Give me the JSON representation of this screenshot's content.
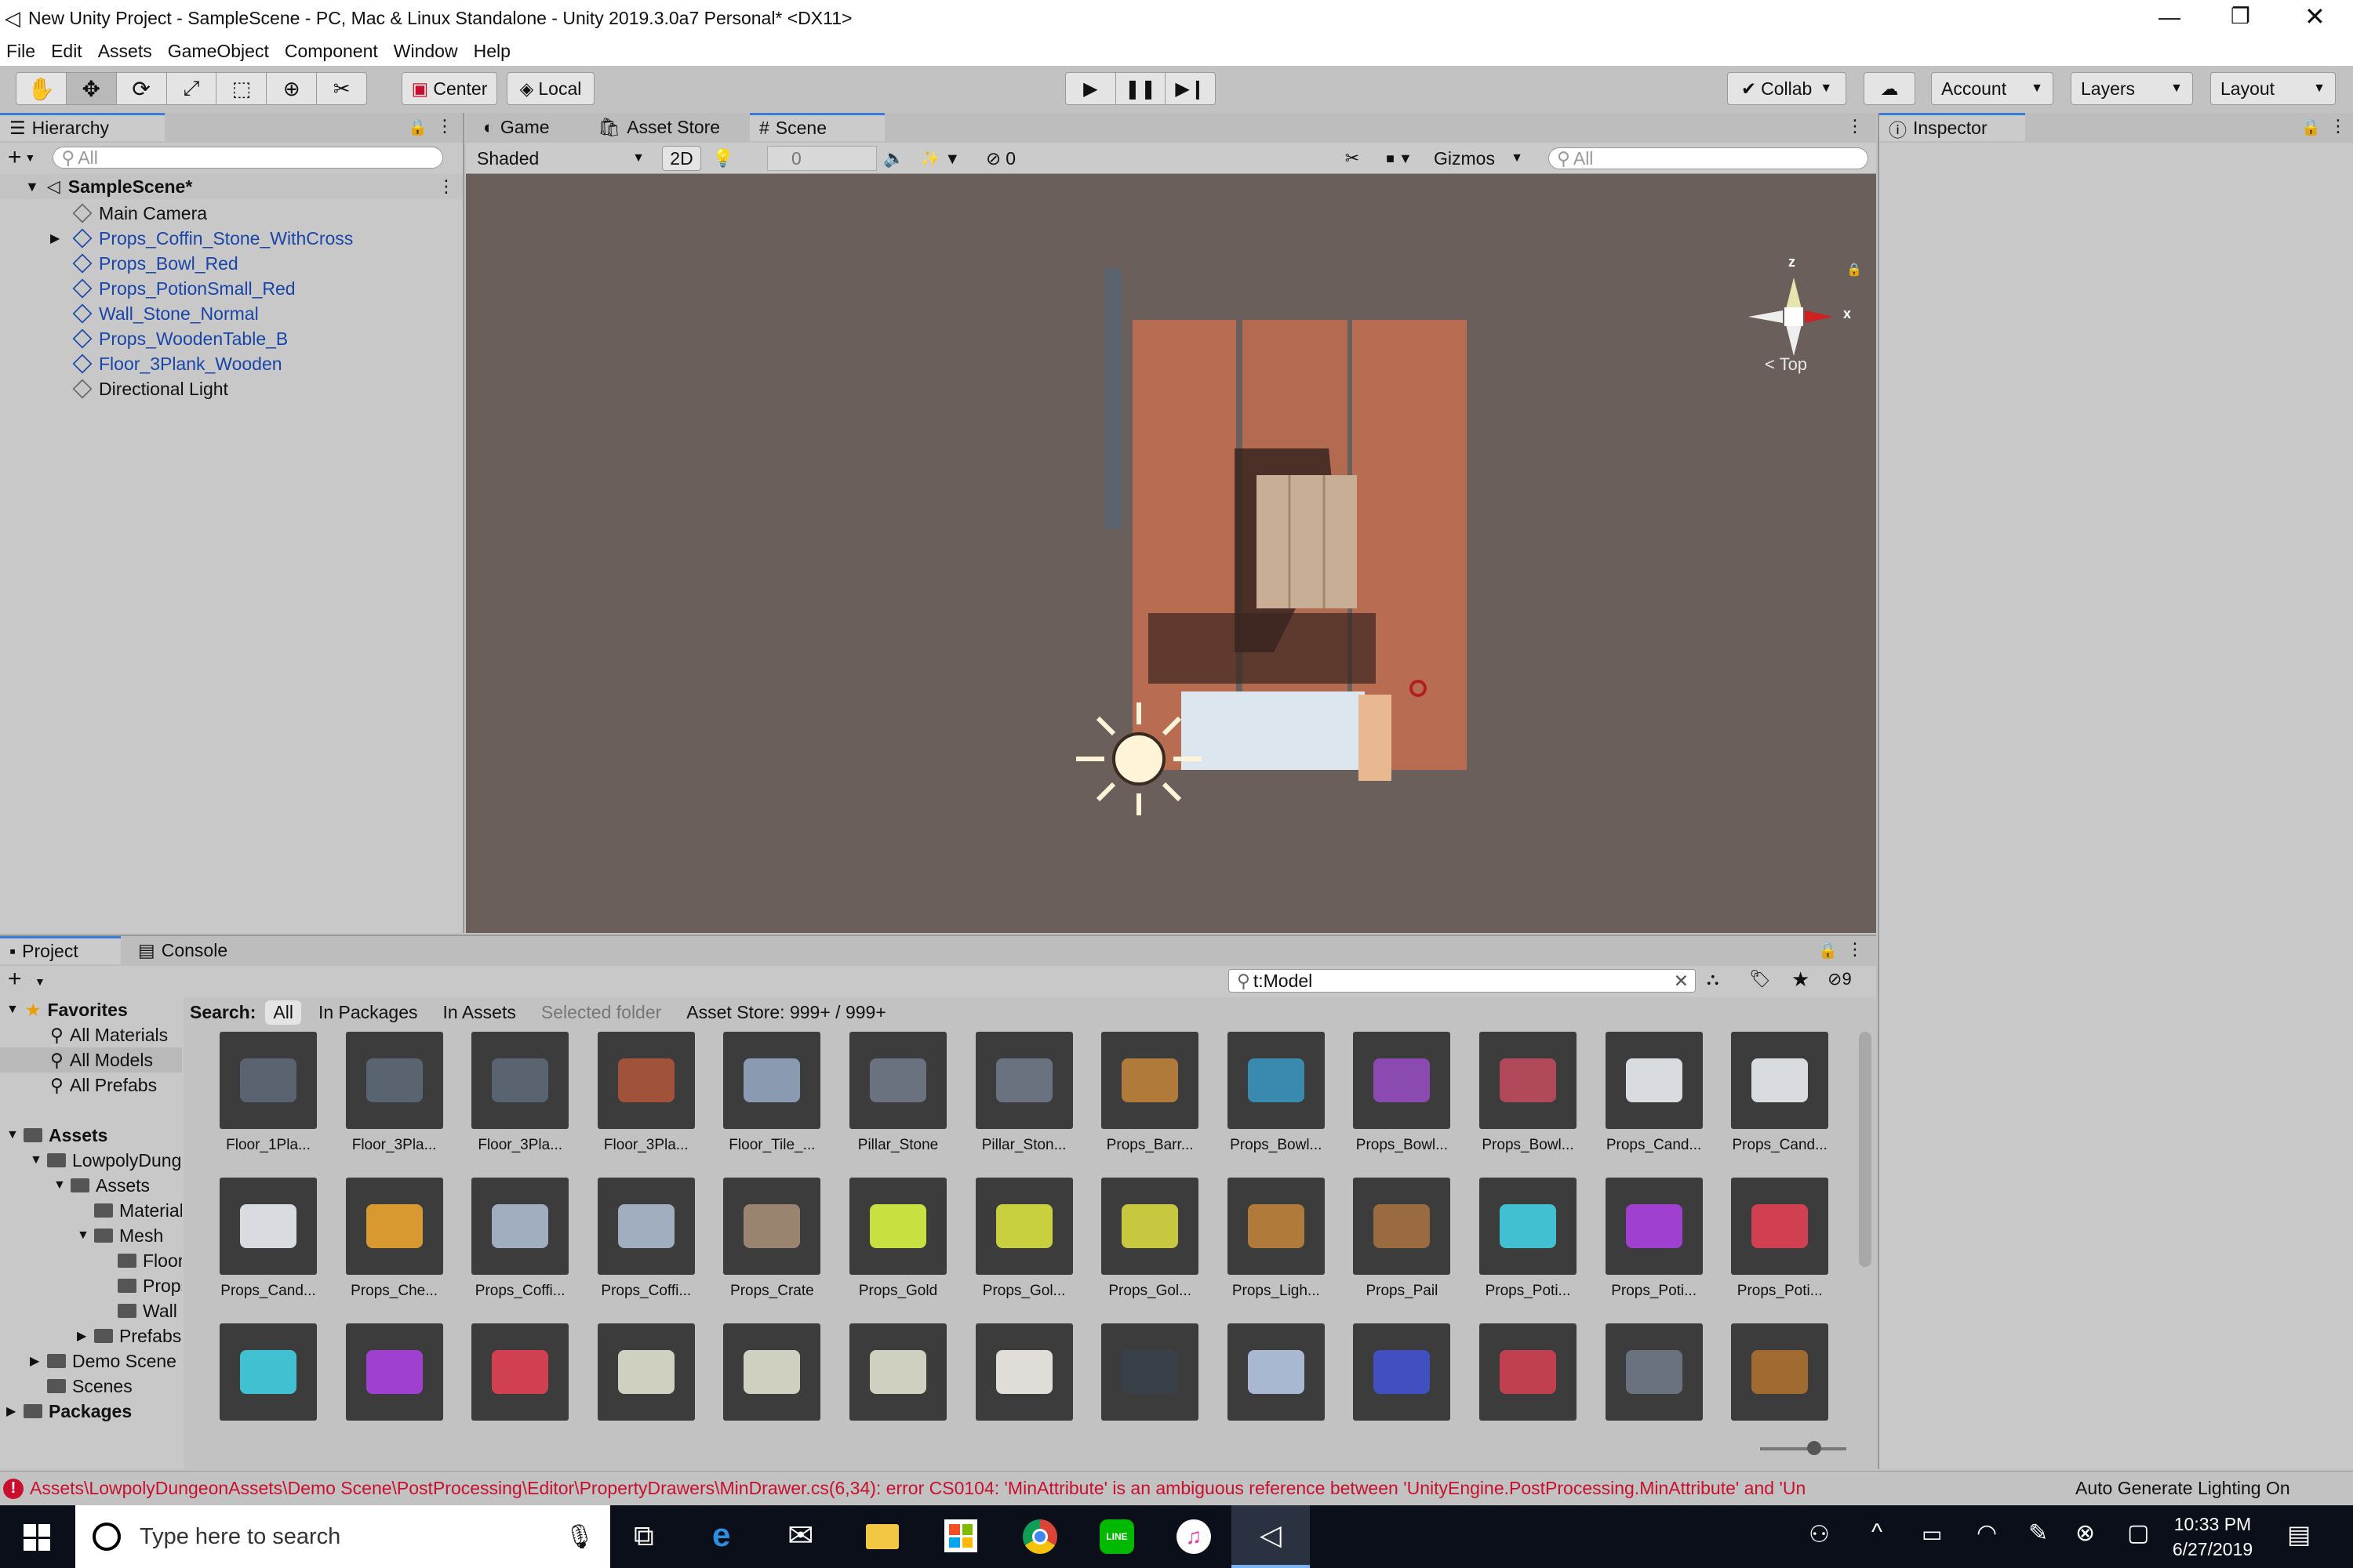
{
  "window": {
    "title": "New Unity Project - SampleScene - PC, Mac & Linux Standalone - Unity 2019.3.0a7 Personal* <DX11>"
  },
  "menu": [
    "File",
    "Edit",
    "Assets",
    "GameObject",
    "Component",
    "Window",
    "Help"
  ],
  "toolbar": {
    "center": "Center",
    "local": "Local",
    "collab": "Collab",
    "account": "Account",
    "layers": "Layers",
    "layout": "Layout"
  },
  "hierarchy": {
    "tab": "Hierarchy",
    "search_placeholder": "All",
    "scene": "SampleScene*",
    "items": [
      "Main Camera",
      "Props_Coffin_Stone_WithCross",
      "Props_Bowl_Red",
      "Props_PotionSmall_Red",
      "Wall_Stone_Normal",
      "Props_WoodenTable_B",
      "Floor_3Plank_Wooden",
      "Directional Light"
    ]
  },
  "scene_tabs": [
    "Game",
    "Asset Store",
    "Scene"
  ],
  "scene_toolbar": {
    "shading": "Shaded",
    "mode2d": "2D",
    "light_value": "0",
    "hidden": "0",
    "gizmos": "Gizmos",
    "search_placeholder": "All"
  },
  "gizmo": {
    "y": "z",
    "x": "x",
    "view": "Top"
  },
  "inspector": {
    "tab": "Inspector"
  },
  "project": {
    "tab": "Project",
    "console_tab": "Console",
    "search_value": "t:Model",
    "hidden_count": "9",
    "search_label": "Search:",
    "filters": [
      "All",
      "In Packages",
      "In Assets",
      "Selected folder"
    ],
    "store": "Asset Store: 999+ / 999+",
    "favorites": {
      "label": "Favorites",
      "items": [
        "All Materials",
        "All Models",
        "All Prefabs"
      ]
    },
    "assets_tree": [
      "Assets",
      "LowpolyDungeonAssets",
      "Assets",
      "Materials",
      "Mesh",
      "Floor",
      "Props",
      "Wall",
      "Prefabs",
      "Demo Scene",
      "Scenes",
      "Packages"
    ],
    "row1": [
      "Floor_1Pla...",
      "Floor_3Pla...",
      "Floor_3Pla...",
      "Floor_3Pla...",
      "Floor_Tile_...",
      "Pillar_Stone",
      "Pillar_Ston...",
      "Props_Barr...",
      "Props_Bowl...",
      "Props_Bowl...",
      "Props_Bowl...",
      "Props_Cand...",
      "Props_Cand..."
    ],
    "row2": [
      "Props_Cand...",
      "Props_Che...",
      "Props_Coffi...",
      "Props_Coffi...",
      "Props_Crate",
      "Props_Gold",
      "Props_Gol...",
      "Props_Gol...",
      "Props_Ligh...",
      "Props_Pail",
      "Props_Poti...",
      "Props_Poti...",
      "Props_Poti..."
    ]
  },
  "status": {
    "error": "Assets\\LowpolyDungeonAssets\\Demo Scene\\PostProcessing\\Editor\\PropertyDrawers\\MinDrawer.cs(6,34): error CS0104: 'MinAttribute' is an ambiguous reference between 'UnityEngine.PostProcessing.MinAttribute' and 'Un",
    "lighting": "Auto Generate Lighting On"
  },
  "taskbar": {
    "search_placeholder": "Type here to search",
    "time": "10:33 PM",
    "date": "6/27/2019"
  },
  "colors": {
    "accent": "#3a7bd5",
    "link": "#1a45a8",
    "error": "#c8102e",
    "floor": "#b86d52"
  }
}
